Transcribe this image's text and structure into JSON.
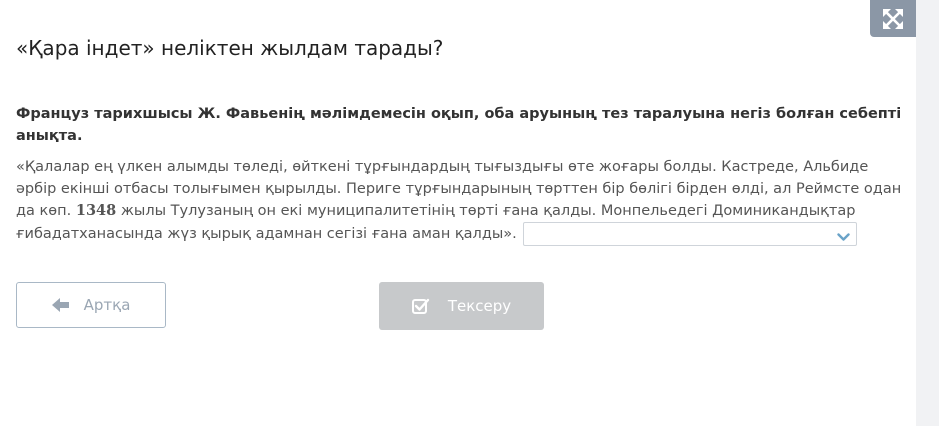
{
  "header": {
    "title": "«Қара індет» неліктен жылдам тарады?"
  },
  "task": {
    "instruction": "Француз тарихшысы Ж. Фавьенің мәлімдемесін оқып, оба аруының тез таралуына негіз болған себепті анықта.",
    "quote_part1": "«Қалалар ең үлкен алымды төледі, өйткені тұрғындардың тығыздығы өте жоғары болды. Кастреде, Альбиде әрбір екінші отбасы толығымен қырылды. Периге тұрғындарының төрттен бір бөлігі бірден өлді, ал Реймсте одан да көп. ",
    "quote_year": "1348",
    "quote_part2": " жылы Тулузаның он екі муниципалитетінің төрті ғана қалды. Монпельедегі Доминикандықтар ғибадатханасында жүз қырық адамнан сегізі ғана аман қалды».",
    "answer_selected": ""
  },
  "buttons": {
    "back_label": "Артқа",
    "check_label": "Тексеру"
  },
  "icons": {
    "fullscreen": "expand-arrows-icon",
    "back": "arrow-left-icon",
    "check": "checkbox-icon",
    "dropdown": "chevron-down-icon"
  },
  "colors": {
    "fullscreen_bg": "#8b97a6",
    "back_border": "#a9b8c6",
    "check_bg": "#c7c9cb",
    "chevron": "#6aa3c8"
  }
}
